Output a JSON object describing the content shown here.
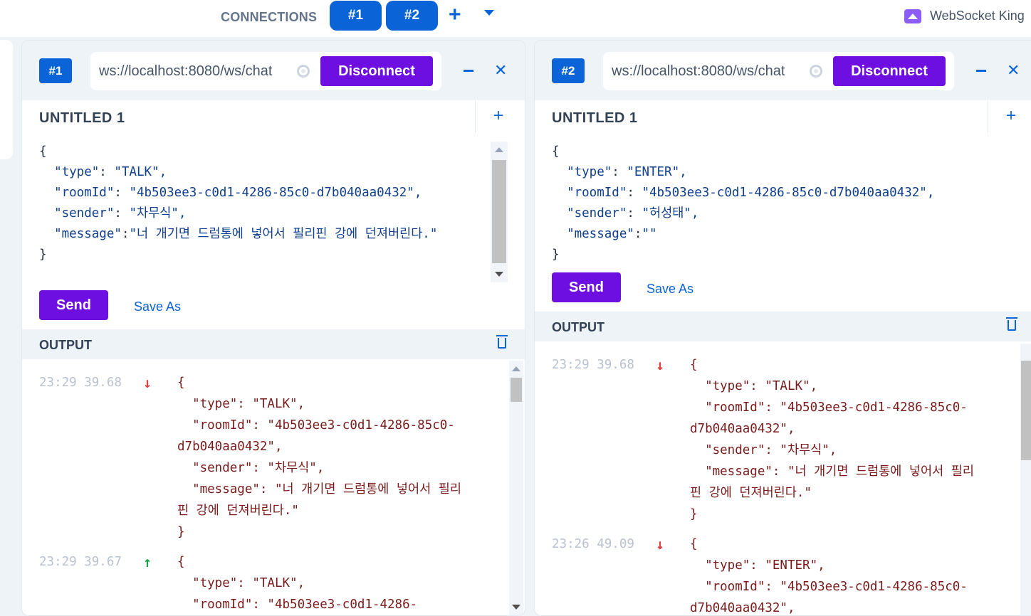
{
  "topbar": {
    "connections_label": "CONNECTIONS",
    "tabs": [
      "#1",
      "#2"
    ],
    "add_icon": "plus-icon",
    "menu_icon": "caret-down-icon",
    "brand_name": "WebSocket King"
  },
  "panels": [
    {
      "badge": "#1",
      "url": "ws://localhost:8080/ws/chat",
      "disconnect_label": "Disconnect",
      "doc_title": "UNTITLED 1",
      "editor": {
        "open": "{",
        "lines": [
          {
            "key": "\"type\"",
            "sep": ": ",
            "val": "\"TALK\","
          },
          {
            "key": "\"roomId\"",
            "sep": ": ",
            "val": "\"4b503ee3-c0d1-4286-85c0-d7b040aa0432\","
          },
          {
            "key": "\"sender\"",
            "sep": ": ",
            "val": "\"차무식\","
          },
          {
            "key": "\"message\"",
            "sep": ":",
            "val": "\"너 개기면 드럼통에 넣어서 필리핀 강에 던져버린다.\""
          }
        ],
        "close": "}"
      },
      "send_label": "Send",
      "save_as_label": "Save As",
      "output_label": "OUTPUT",
      "messages": [
        {
          "time": "23:29 39.68",
          "direction": "received",
          "body": "{\n  \"type\": \"TALK\",\n  \"roomId\": \"4b503ee3-c0d1-4286-85c0-d7b040aa0432\",\n  \"sender\": \"차무식\",\n  \"message\": \"너 개기면 드럼통에 넣어서 필리핀 강에 던져버린다.\"\n}"
        },
        {
          "time": "23:29 39.67",
          "direction": "sent",
          "body": "{\n  \"type\": \"TALK\",\n  \"roomId\": \"4b503ee3-c0d1-4286-"
        }
      ]
    },
    {
      "badge": "#2",
      "url": "ws://localhost:8080/ws/chat",
      "disconnect_label": "Disconnect",
      "doc_title": "UNTITLED 1",
      "editor": {
        "open": "{",
        "lines": [
          {
            "key": "\"type\"",
            "sep": ": ",
            "val": "\"ENTER\","
          },
          {
            "key": "\"roomId\"",
            "sep": ": ",
            "val": "\"4b503ee3-c0d1-4286-85c0-d7b040aa0432\","
          },
          {
            "key": "\"sender\"",
            "sep": ": ",
            "val": "\"허성태\","
          },
          {
            "key": "\"message\"",
            "sep": ":",
            "val": "\"\""
          }
        ],
        "close": "}"
      },
      "send_label": "Send",
      "save_as_label": "Save As",
      "output_label": "OUTPUT",
      "messages": [
        {
          "time": "23:29 39.68",
          "direction": "received",
          "body": "{\n  \"type\": \"TALK\",\n  \"roomId\": \"4b503ee3-c0d1-4286-85c0-d7b040aa0432\",\n  \"sender\": \"차무식\",\n  \"message\": \"너 개기면 드럼통에 넣어서 필리핀 강에 던져버린다.\"\n}"
        },
        {
          "time": "23:26 49.09",
          "direction": "received",
          "body": "{\n  \"type\": \"ENTER\",\n  \"roomId\": \"4b503ee3-c0d1-4286-85c0-d7b040aa0432\","
        }
      ]
    }
  ],
  "icons": {
    "received": "↓",
    "sent": "↑",
    "close": "✕",
    "add": "+"
  },
  "colors": {
    "accent": "#0a64d8",
    "button": "#6d0fe0",
    "received": "#e53e3e",
    "sent": "#16a34a",
    "output_text": "#7a1b1b"
  }
}
